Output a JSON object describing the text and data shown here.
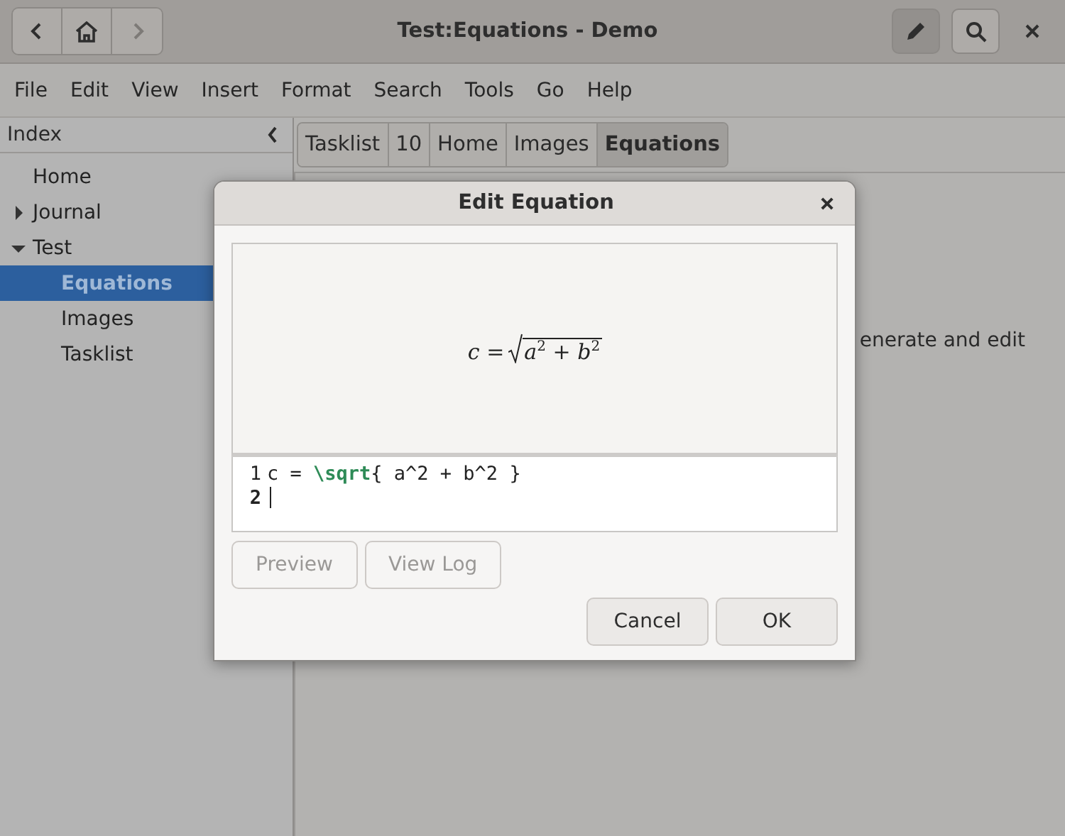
{
  "window": {
    "title": "Test:Equations - Demo"
  },
  "header_buttons": [
    {
      "kind": "back",
      "disabled": false
    },
    {
      "kind": "home",
      "disabled": false
    },
    {
      "kind": "forward",
      "disabled": true
    }
  ],
  "edit_mode": {
    "selected": true
  },
  "menu": [
    "File",
    "Edit",
    "View",
    "Insert",
    "Format",
    "Search",
    "Tools",
    "Go",
    "Help"
  ],
  "sidebar": {
    "title": "Index",
    "items": [
      {
        "label": "Home",
        "selected": false
      },
      {
        "label": "Journal",
        "expanded": false,
        "selected": false
      },
      {
        "label": "Test",
        "expanded": true,
        "selected": false,
        "children": [
          {
            "label": "Equations",
            "selected": true
          },
          {
            "label": "Images",
            "selected": false
          },
          {
            "label": "Tasklist",
            "selected": false
          }
        ]
      }
    ]
  },
  "pathbar": [
    {
      "label": "Tasklist",
      "selected": false
    },
    {
      "label": "10",
      "selected": false
    },
    {
      "label": "Home",
      "selected": false
    },
    {
      "label": "Images",
      "selected": false
    },
    {
      "label": "Equations",
      "selected": true
    }
  ],
  "page": {
    "body_fragment": "enerate and edit"
  },
  "dialog": {
    "title": "Edit Equation",
    "preview": {
      "lhs": "c =",
      "radicand": "a$^{2}$ + b$^{2}$"
    },
    "editor": {
      "lines": [
        {
          "number": "1",
          "current": false,
          "tokens": [
            {
              "text": "c = ",
              "kind": "plain"
            },
            {
              "text": "\\sqrt",
              "kind": "command"
            },
            {
              "text": "{ a^2 + b^2 }",
              "kind": "plain"
            }
          ]
        },
        {
          "number": "2",
          "current": true
        }
      ]
    },
    "tool_buttons": [
      {
        "label": "Preview",
        "disabled": true
      },
      {
        "label": "View Log",
        "disabled": true
      }
    ],
    "buttons": [
      {
        "label": "Cancel",
        "disabled": false
      },
      {
        "label": "OK",
        "disabled": false
      }
    ]
  }
}
